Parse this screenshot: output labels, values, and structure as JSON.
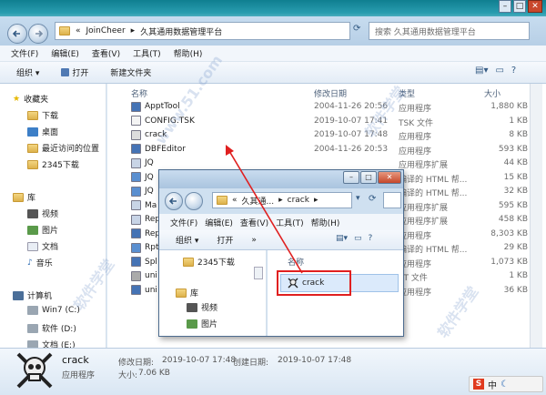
{
  "breadcrumb": {
    "root": "JoinCheer",
    "current": "久其通用数据管理平台"
  },
  "search": {
    "placeholder": "搜索 久其通用数据管理平台"
  },
  "menu": [
    "文件(F)",
    "编辑(E)",
    "查看(V)",
    "工具(T)",
    "帮助(H)"
  ],
  "toolbar": {
    "organize": "组织",
    "open": "打开",
    "new_folder": "新建文件夹"
  },
  "nav": {
    "favorites": "收藏夹",
    "downloads": "下载",
    "desktop": "桌面",
    "recent": "最近访问的位置",
    "dl2345": "2345下载",
    "libraries": "库",
    "videos": "视频",
    "pictures": "图片",
    "documents": "文档",
    "music": "音乐",
    "computer": "计算机",
    "drive_c": "Win7 (C:)",
    "drive_d": "软件 (D:)",
    "drive_e": "文档 (E:)"
  },
  "columns": {
    "name": "名称",
    "modified": "修改日期",
    "type": "类型",
    "size": "大小"
  },
  "files": [
    {
      "name": "ApptTool",
      "date": "2004-11-26 20:56",
      "type": "应用程序",
      "size": "1,880 KB"
    },
    {
      "name": "CONFIG.TSK",
      "date": "2019-10-07 17:41",
      "type": "TSK 文件",
      "size": "1 KB"
    },
    {
      "name": "crack",
      "date": "2019-10-07 17:48",
      "type": "应用程序",
      "size": "8 KB"
    },
    {
      "name": "DBFEditor",
      "date": "2004-11-26 20:53",
      "type": "应用程序",
      "size": "593 KB"
    },
    {
      "name": "JQ",
      "date": "",
      "type": "应用程序扩展",
      "size": "44 KB"
    },
    {
      "name": "JQ",
      "date": "",
      "type": "编译的 HTML 帮...",
      "size": "15 KB"
    },
    {
      "name": "JQ",
      "date": "",
      "type": "编译的 HTML 帮...",
      "size": "32 KB"
    },
    {
      "name": "Ma",
      "date": "",
      "type": "应用程序扩展",
      "size": "595 KB"
    },
    {
      "name": "Rep",
      "date": "",
      "type": "应用程序扩展",
      "size": "458 KB"
    },
    {
      "name": "Rep",
      "date": "",
      "type": "应用程序",
      "size": "8,303 KB"
    },
    {
      "name": "Rpt",
      "date": "",
      "type": "编译的 HTML 帮...",
      "size": "29 KB"
    },
    {
      "name": "Spl",
      "date": "",
      "type": "应用程序",
      "size": "1,073 KB"
    },
    {
      "name": "uni",
      "date": "",
      "type": "AT 文件",
      "size": "1 KB"
    },
    {
      "name": "uni",
      "date": "",
      "type": "应用程序",
      "size": "36 KB"
    }
  ],
  "details": {
    "name": "crack",
    "type": "应用程序",
    "modified_label": "修改日期:",
    "modified": "2019-10-07 17:48",
    "created_label": "创建日期:",
    "created": "2019-10-07 17:48",
    "size_label": "大小:",
    "size": "7.06 KB"
  },
  "dialog": {
    "breadcrumb1": "久其通...",
    "breadcrumb2": "crack",
    "menu": [
      "文件(F)",
      "编辑(E)",
      "查看(V)",
      "工具(T)",
      "帮助(H)"
    ],
    "organize": "组织",
    "open": "打开",
    "more": "»",
    "col_name": "名称",
    "nav_dl": "2345下载",
    "nav_lib": "库",
    "nav_video": "视频",
    "nav_pic": "图片",
    "file": "crack"
  },
  "watermark": {
    "site": "www.51.com",
    "brand": "软件学堂"
  },
  "tray": {
    "ime": "中"
  },
  "colors": {
    "accent": "#e02020",
    "banner": "#1d8ea1"
  }
}
